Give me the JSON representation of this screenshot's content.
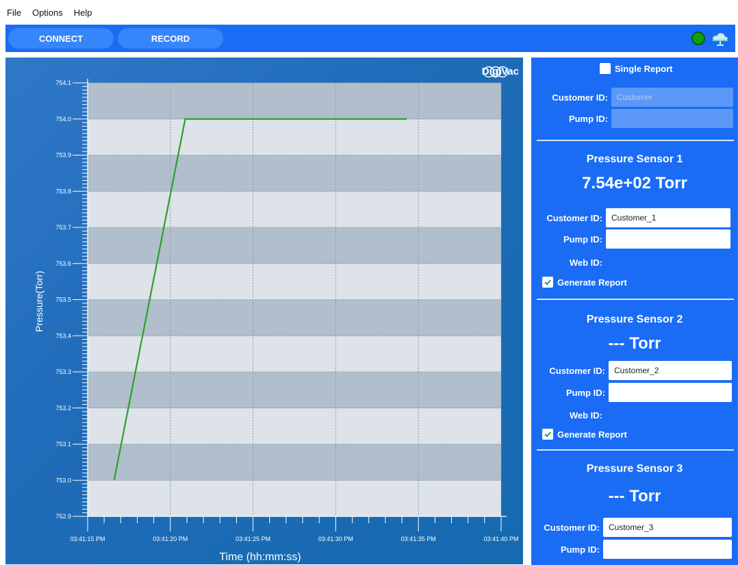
{
  "menu": {
    "items": [
      "File",
      "Options",
      "Help"
    ]
  },
  "toolbar": {
    "connect_label": "CONNECT",
    "record_label": "RECORD",
    "status_color": "#0fa00f"
  },
  "brand": {
    "name": "DigiVac"
  },
  "chart_data": {
    "type": "line",
    "ylabel": "Pressure(Torr)",
    "xlabel": "Time (hh:mm:ss)",
    "ylim": [
      752.9,
      754.1
    ],
    "yticks": [
      "752.9",
      "753.0",
      "753.1",
      "753.2",
      "753.3",
      "753.4",
      "753.5",
      "753.6",
      "753.7",
      "753.8",
      "753.9",
      "754.0",
      "754.1"
    ],
    "xticks": [
      "03:41:15 PM",
      "03:41:20 PM",
      "03:41:25 PM",
      "03:41:30 PM",
      "03:41:35 PM",
      "03:41:40 PM"
    ],
    "xlim": [
      0,
      25
    ],
    "grid": true,
    "series": [
      {
        "color": "#2aa02a",
        "x": [
          1.6,
          5.9,
          19.3
        ],
        "y": [
          753.0,
          754.0,
          754.0
        ]
      }
    ]
  },
  "side": {
    "single_report_label": "Single Report",
    "customer_id_label": "Customer ID:",
    "pump_id_label": "Pump ID:",
    "web_id_label": "Web ID:",
    "generate_report_label": "Generate Report",
    "top_customer_placeholder": "Customer",
    "sensor1": {
      "title": "Pressure Sensor 1",
      "reading": "7.54e+02 Torr",
      "customer_id": "Customer_1"
    },
    "sensor2": {
      "title": "Pressure Sensor 2",
      "reading": "--- Torr",
      "customer_id": "Customer_2"
    },
    "sensor3": {
      "title": "Pressure Sensor 3",
      "reading": "--- Torr",
      "customer_id": "Customer_3"
    }
  }
}
